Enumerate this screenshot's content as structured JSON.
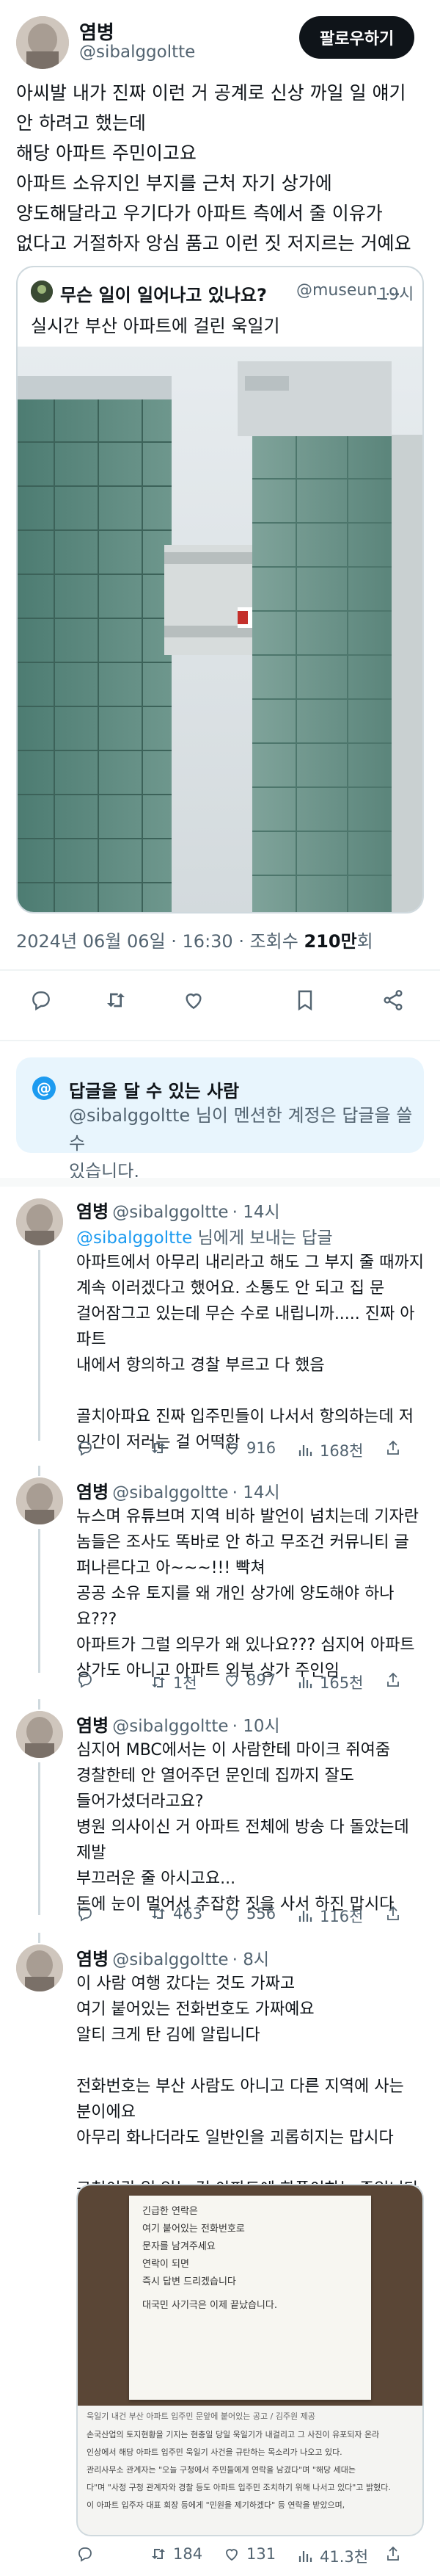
{
  "main_tweet": {
    "author_name": "염병",
    "author_handle": "@sibalggoltte",
    "follow_label": "팔로우하기",
    "lines": [
      "아씨발 내가 진짜 이런 거 공계로 신상 까일 일 얘기",
      "안 하려고 했는데",
      "해당 아파트 주민이고요",
      "아파트 소유지인 부지를 근처 자기 상가에",
      "양도해달라고 우기다가 아파트 측에서 줄 이유가",
      "없다고 거절하자 앙심 품고 이런 짓 저지르는 거예요"
    ],
    "quote": {
      "title": "무슨 일이 일어나고 있나요?",
      "handle": "@museun_...",
      "time": "· 19시",
      "text": "실시간 부산 아파트에 걸린 욱일기"
    },
    "timestamp": "2024년 06월 06일 · 16:30 · 조회수",
    "views": "210만",
    "views_suffix": "회"
  },
  "reply_notice": {
    "title": "답글을 달 수 있는 사람",
    "handle": "@sibalggoltte",
    "text_after_handle": " 님이 멘션한 계정은 답글을 쓸 수",
    "text_line2": "있습니다."
  },
  "replies": [
    {
      "name": "염병",
      "handle": "@sibalggoltte",
      "time": "· 14시",
      "reply_to_handle": "@sibalggoltte",
      "reply_to_suffix": " 님에게 보내는 답글",
      "text": "아파트에서 아무리 내리라고 해도 그 부지 줄 때까지\n계속 이러겠다고 했어요. 소통도 안 되고 집 문\n걸어잠그고 있는데 무슨 수로 내립니까..... 진짜 아파트\n내에서 항의하고 경찰 부르고 다 했음\n\n골치아파요 진짜 입주민들이 나서서 항의하는데 저\n인간이 저러는 걸 어떡함",
      "actions": {
        "replies": "",
        "retweets": "",
        "likes": "916",
        "views": "168천"
      }
    },
    {
      "name": "염병",
      "handle": "@sibalggoltte",
      "time": "· 14시",
      "text": "뉴스며 유튜브며 지역 비하 발언이 넘치는데 기자란\n놈들은 조사도 똑바로 안 하고 무조건 커뮤니티 글\n퍼나른다고 아~~~!!! 빡쳐\n공공 소유 토지를 왜 개인 상가에 양도해야 하나요???\n아파트가 그럴 의무가 왜 있나요??? 심지어 아파트\n상가도 아니고 아파트 외부 상가 주인임",
      "actions": {
        "replies": "",
        "retweets": "1천",
        "likes": "897",
        "views": "165천"
      }
    },
    {
      "name": "염병",
      "handle": "@sibalggoltte",
      "time": "· 10시",
      "text": "심지어 MBC에서는 이 사람한테 마이크 쥐여줌\n경찰한테 안 열어주던 문인데 집까지 잘도\n들어가셨더라고요?\n병원 의사이신 거 아파트 전체에 방송 다 돌았는데 제발\n부끄러운 줄 아시고요...\n돈에 눈이 멀어서 추잡한 짓을 사서 하진 맙시다",
      "actions": {
        "replies": "",
        "retweets": "463",
        "likes": "556",
        "views": "116천"
      }
    },
    {
      "name": "염병",
      "handle": "@sibalggoltte",
      "time": "· 8시",
      "text": "이 사람 여행 갔다는 것도 가짜고\n여기 붙어있는 전화번호도 가짜예요\n알티 크게 탄 김에 알립니다\n\n전화번호는 부산 사람도 아니고 다른 지역에 사는\n분이에요\n아무리 화나더라도 일반인을 괴롭히지는 맙시다\n\n구청이랑 일 있는 걸 아파트에 화풀이하는 중입니다",
      "notice_lines": [
        "긴급한 연락은",
        "여기 붙어있는 전화번호로",
        "문자를 남겨주세요",
        "연락이 되면",
        "즉시 답변 드리겠습니다",
        "대국민 사기극은 이제 끝났습니다."
      ],
      "caption": "욱일기 내건 부산 아파트 입주민 문앞에 붙어있는 공고 / 김주원 제공",
      "article_lines": [
        "손국산업의 토지현황을 기지는 현충일 당일 욱일기가 내걸리고 그 사진이 유포되자 온라",
        "인상에서 해당 아파트 입주민 욱일기 사건을 규탄하는 목소리가 나오고 있다.",
        "관리사무소 관계자는 \"오늘 구청에서 주민들에게 연락을 남겼다\"며 \"해당 세대는",
        "다\"며 \"사정 구청 관계자와 경찰 등도 아파트 입주민 조치하기 위해 나서고 있다\"고 밝혔다.",
        "이 아파트 입주자 대표 회장 등에게 \"민원을 제기하겠다\" 등 연락을 받았으며,"
      ],
      "actions": {
        "replies": "",
        "retweets": "184",
        "likes": "131",
        "views": "41.3천"
      }
    }
  ],
  "colors": {
    "text_primary": "#0f1419",
    "text_secondary": "#536471",
    "accent_blue": "#1d9bf0",
    "divider": "#eff3f4",
    "notice_bg": "#e8f5fd"
  },
  "icons": [
    "reply-icon",
    "retweet-icon",
    "like-icon",
    "views-icon",
    "bookmark-icon",
    "share-icon",
    "at-icon",
    "avatar-icon"
  ]
}
